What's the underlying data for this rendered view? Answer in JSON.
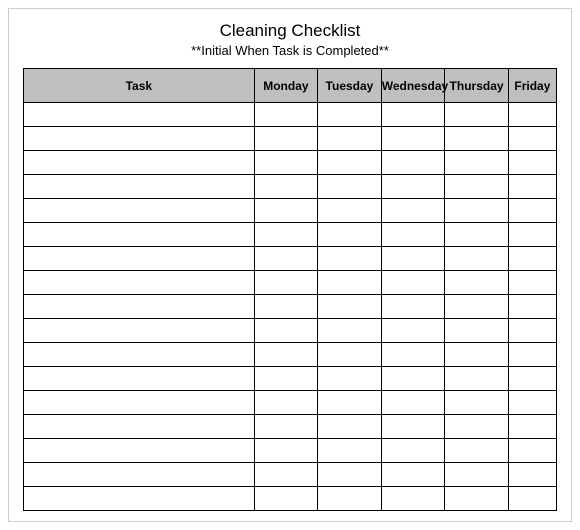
{
  "title": "Cleaning Checklist",
  "subtitle": "**Initial When Task is Completed**",
  "headers": {
    "task": "Task",
    "monday": "Monday",
    "tuesday": "Tuesday",
    "wednesday": "Wednesday",
    "thursday": "Thursday",
    "friday": "Friday"
  },
  "row_count": 17
}
